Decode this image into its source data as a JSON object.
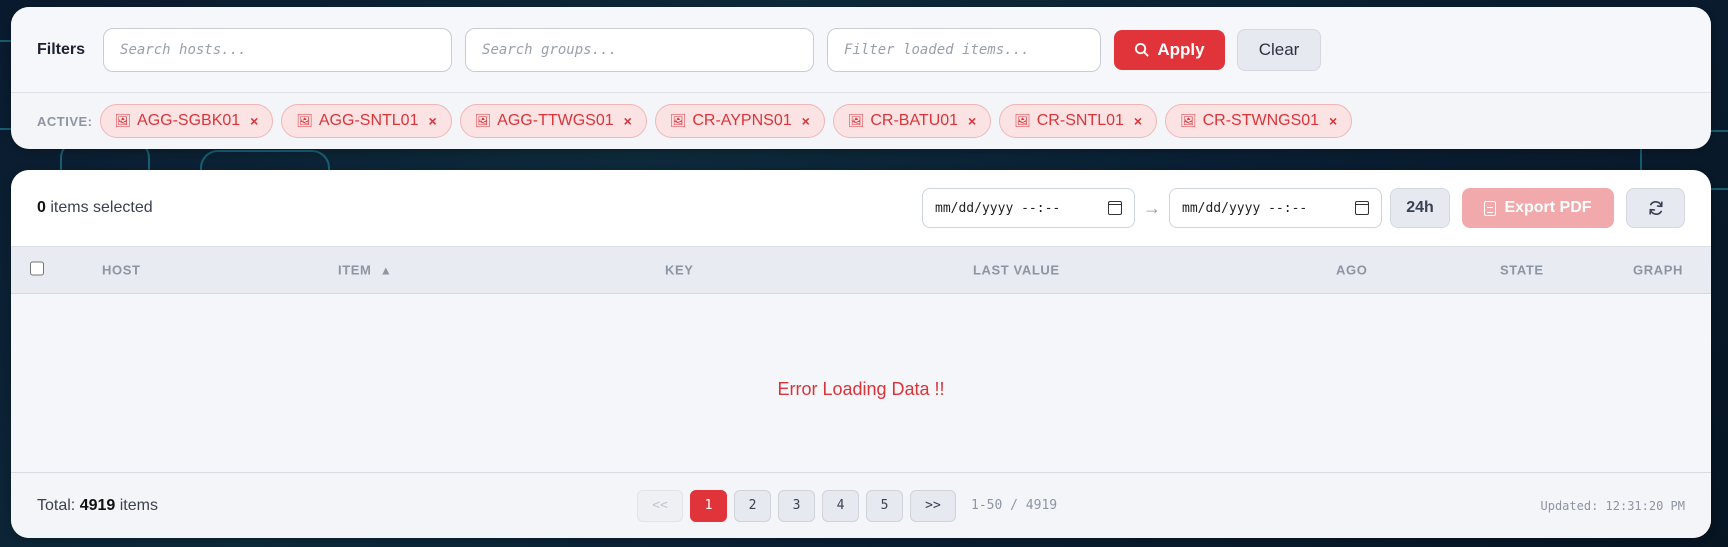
{
  "filters": {
    "title": "Filters",
    "hosts_placeholder": "Search hosts...",
    "groups_placeholder": "Search groups...",
    "items_placeholder": "Filter loaded items...",
    "apply_label": "Apply",
    "clear_label": "Clear",
    "active_label": "ACTIVE:",
    "active_chips": [
      "AGG-SGBK01",
      "AGG-SNTL01",
      "AGG-TTWGS01",
      "CR-AYPNS01",
      "CR-BATU01",
      "CR-SNTL01",
      "CR-STWNGS01"
    ],
    "chip_remove_glyph": "×",
    "chip_icon": "🖼"
  },
  "toolbar": {
    "selected_count": "0",
    "selected_suffix": " items selected",
    "date_from": "mm/dd/yyyy --:--",
    "date_arrow": "→",
    "date_to": "mm/dd/yyyy --:--",
    "range_button": "24h",
    "export_label": "Export PDF"
  },
  "table": {
    "columns": {
      "host": "HOST",
      "item": "ITEM",
      "sort_glyph": "▲",
      "key": "KEY",
      "last_value": "LAST VALUE",
      "ago": "AGO",
      "state": "STATE",
      "graph": "GRAPH"
    },
    "error_message": "Error Loading Data !!"
  },
  "footer": {
    "total_prefix": "Total: ",
    "total_count": "4919",
    "total_suffix": " items",
    "first_label": "<<",
    "pages": [
      "1",
      "2",
      "3",
      "4",
      "5"
    ],
    "next_label": ">>",
    "range_text": "1-50 / 4919",
    "updated_text": "Updated: 12:31:20 PM"
  },
  "colors": {
    "accent": "#e0343a",
    "accent_disabled": "#f2a9ab",
    "chip_bg": "#fbe3e4"
  }
}
